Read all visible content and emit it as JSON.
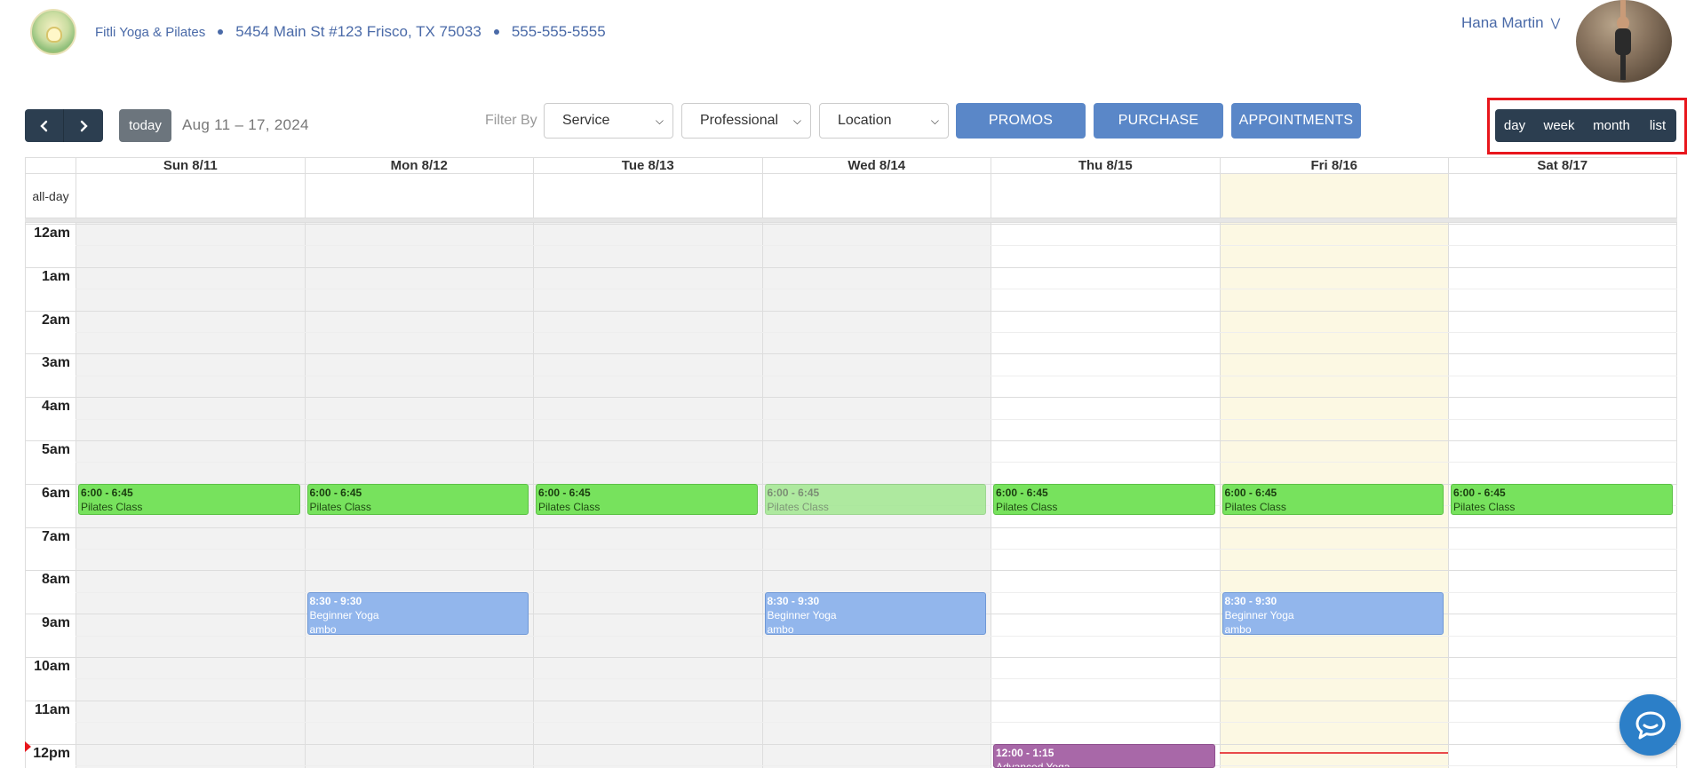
{
  "header": {
    "business_name": "Fitli Yoga & Pilates",
    "address": "5454 Main St #123 Frisco, TX 75033",
    "phone": "555-555-5555",
    "user_name": "Hana Martin"
  },
  "toolbar": {
    "prev_icon": "chevron-left-icon",
    "next_icon": "chevron-right-icon",
    "today_label": "today",
    "range_title": "Aug 11 – 17, 2024",
    "filter_label": "Filter By",
    "filters": [
      {
        "value": "Service"
      },
      {
        "value": "Professional"
      },
      {
        "value": "Location"
      }
    ],
    "promos_label": "PROMOS",
    "purchase_label": "PURCHASE",
    "appointments_label": "APPOINTMENTS",
    "views": [
      {
        "label": "day",
        "active": false
      },
      {
        "label": "week",
        "active": true
      },
      {
        "label": "month",
        "active": false
      },
      {
        "label": "list",
        "active": false
      }
    ]
  },
  "calendar": {
    "allday_label": "all-day",
    "days": [
      {
        "label": "Sun 8/11",
        "past": true,
        "today": false
      },
      {
        "label": "Mon 8/12",
        "past": true,
        "today": false
      },
      {
        "label": "Tue 8/13",
        "past": true,
        "today": false
      },
      {
        "label": "Wed 8/14",
        "past": true,
        "today": false
      },
      {
        "label": "Thu 8/15",
        "past": false,
        "today": false
      },
      {
        "label": "Fri 8/16",
        "past": false,
        "today": true
      },
      {
        "label": "Sat 8/17",
        "past": false,
        "today": false
      }
    ],
    "hours": [
      "12am",
      "1am",
      "2am",
      "3am",
      "4am",
      "5am",
      "6am",
      "7am",
      "8am",
      "9am",
      "10am",
      "11am",
      "12pm"
    ],
    "events": [
      {
        "day": 0,
        "start": 6.0,
        "end": 6.75,
        "time": "6:00 - 6:45",
        "title": "Pilates Class",
        "sub": "",
        "kind": "pilates",
        "faded": false
      },
      {
        "day": 1,
        "start": 6.0,
        "end": 6.75,
        "time": "6:00 - 6:45",
        "title": "Pilates Class",
        "sub": "",
        "kind": "pilates",
        "faded": false
      },
      {
        "day": 2,
        "start": 6.0,
        "end": 6.75,
        "time": "6:00 - 6:45",
        "title": "Pilates Class",
        "sub": "",
        "kind": "pilates",
        "faded": false
      },
      {
        "day": 3,
        "start": 6.0,
        "end": 6.75,
        "time": "6:00 - 6:45",
        "title": "Pilates Class",
        "sub": "",
        "kind": "pilates",
        "faded": true
      },
      {
        "day": 4,
        "start": 6.0,
        "end": 6.75,
        "time": "6:00 - 6:45",
        "title": "Pilates Class",
        "sub": "",
        "kind": "pilates",
        "faded": false
      },
      {
        "day": 5,
        "start": 6.0,
        "end": 6.75,
        "time": "6:00 - 6:45",
        "title": "Pilates Class",
        "sub": "",
        "kind": "pilates",
        "faded": false
      },
      {
        "day": 6,
        "start": 6.0,
        "end": 6.75,
        "time": "6:00 - 6:45",
        "title": "Pilates Class",
        "sub": "",
        "kind": "pilates",
        "faded": false
      },
      {
        "day": 1,
        "start": 8.5,
        "end": 9.5,
        "time": "8:30 - 9:30",
        "title": "Beginner Yoga",
        "sub": "ambo",
        "kind": "yoga",
        "faded": false
      },
      {
        "day": 3,
        "start": 8.5,
        "end": 9.5,
        "time": "8:30 - 9:30",
        "title": "Beginner Yoga",
        "sub": "ambo",
        "kind": "yoga",
        "faded": false
      },
      {
        "day": 5,
        "start": 8.5,
        "end": 9.5,
        "time": "8:30 - 9:30",
        "title": "Beginner Yoga",
        "sub": "ambo",
        "kind": "yoga",
        "faded": false
      },
      {
        "day": 4,
        "start": 12.0,
        "end": 13.25,
        "time": "12:00 - 1:15",
        "title": "Advanced Yoga",
        "sub": "",
        "kind": "adv",
        "faded": false
      }
    ],
    "now_hour": 12.2
  },
  "chat": {
    "icon": "chat-bubble-icon"
  },
  "colors": {
    "nav_dark": "#2c3e50",
    "action_blue": "#5a87c8",
    "pilates_green": "#77e25d",
    "yoga_blue": "#92b6ec",
    "advanced_purple": "#a868a8",
    "today_bg": "#fcf8e3",
    "past_bg": "#f2f2f2",
    "now_line": "#e84a4a",
    "highlight_red": "#e8161c"
  }
}
